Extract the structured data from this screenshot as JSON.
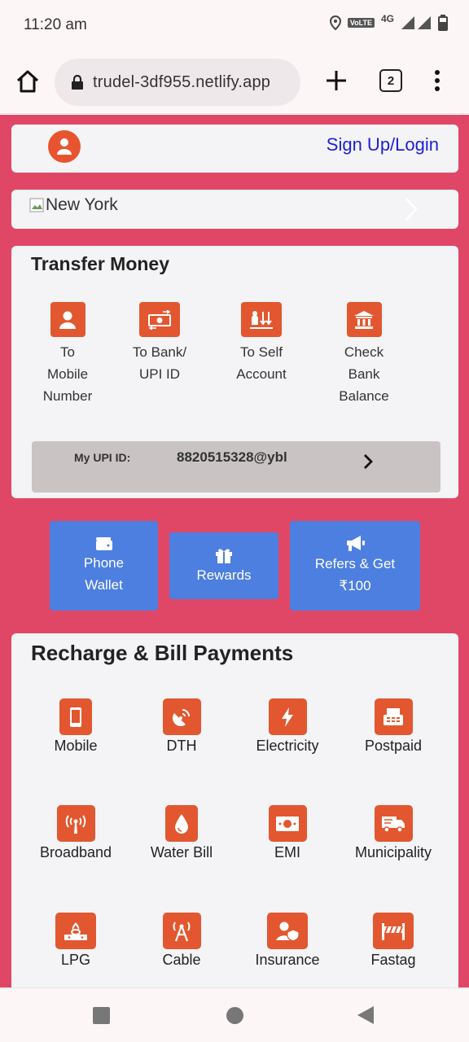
{
  "status_bar": {
    "time": "11:20 am",
    "volte": "VoLTE",
    "network": "4G"
  },
  "browser": {
    "url": "trudel-3df955.netlify.app",
    "tab_count": "2"
  },
  "header": {
    "login_label": "Sign Up/Login"
  },
  "banner": {
    "alt_text": "New York"
  },
  "transfer": {
    "title": "Transfer Money",
    "items": [
      {
        "label_lines": [
          "To",
          "Mobile",
          "Number"
        ],
        "icon": "user-icon"
      },
      {
        "label_lines": [
          "To Bank/",
          "UPI ID"
        ],
        "icon": "bank-transfer-icon"
      },
      {
        "label_lines": [
          "To Self",
          "Account"
        ],
        "icon": "self-transfer-icon"
      },
      {
        "label_lines": [
          "Check",
          "Bank",
          "Balance"
        ],
        "icon": "bank-building-icon"
      }
    ],
    "upi_label": "My UPI ID:",
    "upi_value": "8820515328@ybl"
  },
  "quick_actions": {
    "wallet": [
      "Phone",
      "Wallet"
    ],
    "rewards": "Rewards",
    "refer": [
      "Refers & Get",
      "₹100"
    ]
  },
  "recharge": {
    "title": "Recharge & Bill Payments",
    "items": [
      {
        "label": "Mobile",
        "icon": "mobile-icon"
      },
      {
        "label": "DTH",
        "icon": "satellite-dish-icon"
      },
      {
        "label": "Electricity",
        "icon": "lightning-icon"
      },
      {
        "label": "Postpaid",
        "icon": "fax-icon"
      },
      {
        "label": "Broadband",
        "icon": "broadcast-tower-icon"
      },
      {
        "label": "Water Bill",
        "icon": "water-drop-icon"
      },
      {
        "label": "EMI",
        "icon": "money-bill-icon"
      },
      {
        "label": "Municipality",
        "icon": "truck-icon"
      },
      {
        "label": "LPG",
        "icon": "gas-burner-icon"
      },
      {
        "label": "Cable",
        "icon": "antenna-icon"
      },
      {
        "label": "Insurance",
        "icon": "user-shield-icon"
      },
      {
        "label": "Fastag",
        "icon": "toll-barrier-icon"
      }
    ]
  },
  "colors": {
    "page_bg": "#e04767",
    "accent_orange": "#e2572f",
    "button_blue": "#4c7fe0",
    "link_blue": "#1d1fd4"
  }
}
